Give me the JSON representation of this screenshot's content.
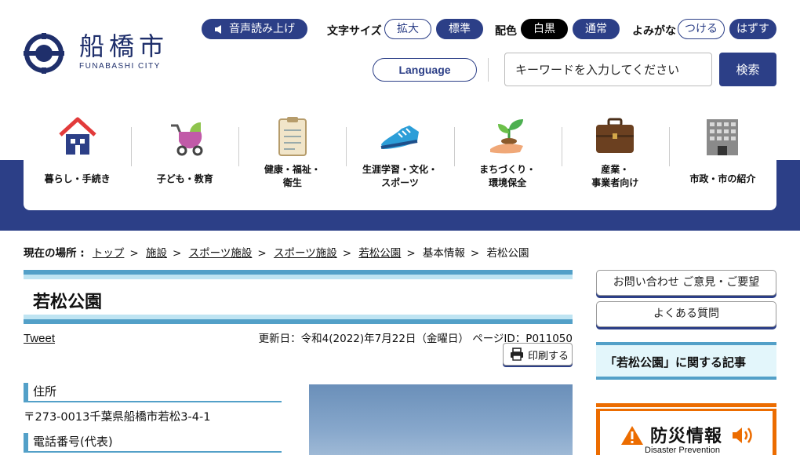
{
  "site": {
    "logo_kanji": "船橋市",
    "logo_roman": "FUNABASHI CITY"
  },
  "header": {
    "speech_label": "音声読み上げ",
    "font_size_label": "文字サイズ",
    "font_size_options": [
      "拡大",
      "標準"
    ],
    "color_label": "配色",
    "color_options": [
      "白黒",
      "通常"
    ],
    "furigana_label": "よみがな",
    "furigana_options": [
      "つける",
      "はずす"
    ],
    "language_label": "Language",
    "search_placeholder": "キーワードを入力してください",
    "search_button": "検索"
  },
  "nav": {
    "items": [
      {
        "label": "暮らし・手続き",
        "icon": "house-icon"
      },
      {
        "label": "子ども・教育",
        "icon": "stroller-icon"
      },
      {
        "label": "健康・福祉・\n衛生",
        "icon": "clipboard-icon"
      },
      {
        "label": "生涯学習・文化・\nスポーツ",
        "icon": "sneaker-icon"
      },
      {
        "label": "まちづくり・\n環境保全",
        "icon": "sprout-hand-icon"
      },
      {
        "label": "産業・\n事業者向け",
        "icon": "briefcase-icon"
      },
      {
        "label": "市政・市の紹介",
        "icon": "building-icon"
      }
    ]
  },
  "breadcrumb": {
    "heading": "現在の場所 :",
    "links": [
      "トップ",
      "施設",
      "スポーツ施設",
      "スポーツ施設",
      "若松公園"
    ],
    "plain": [
      "基本情報",
      "若松公園"
    ],
    "separator": ">"
  },
  "main": {
    "title": "若松公園",
    "tweet": "Tweet",
    "updated": "更新日：令和4(2022)年7月22日（金曜日）",
    "page_id": "ページID：P011050",
    "print_label": "印刷する",
    "sections": [
      {
        "heading": "住所",
        "text": "〒273-0013千葉県船橋市若松3-4-1"
      },
      {
        "heading": "電話番号(代表)",
        "text": ""
      }
    ]
  },
  "side": {
    "contact_button": "お問い合わせ ご意見・ご要望",
    "faq_button": "よくある質問",
    "related_heading": "「若松公園」に関する記事",
    "disaster_jp": "防災情報",
    "disaster_en": "Disaster Prevention"
  },
  "colors": {
    "brand_navy": "#2c3f87",
    "accent_blue": "#53a0c8",
    "light_blue": "#bfe4f2",
    "disaster_orange": "#ec6c00"
  }
}
